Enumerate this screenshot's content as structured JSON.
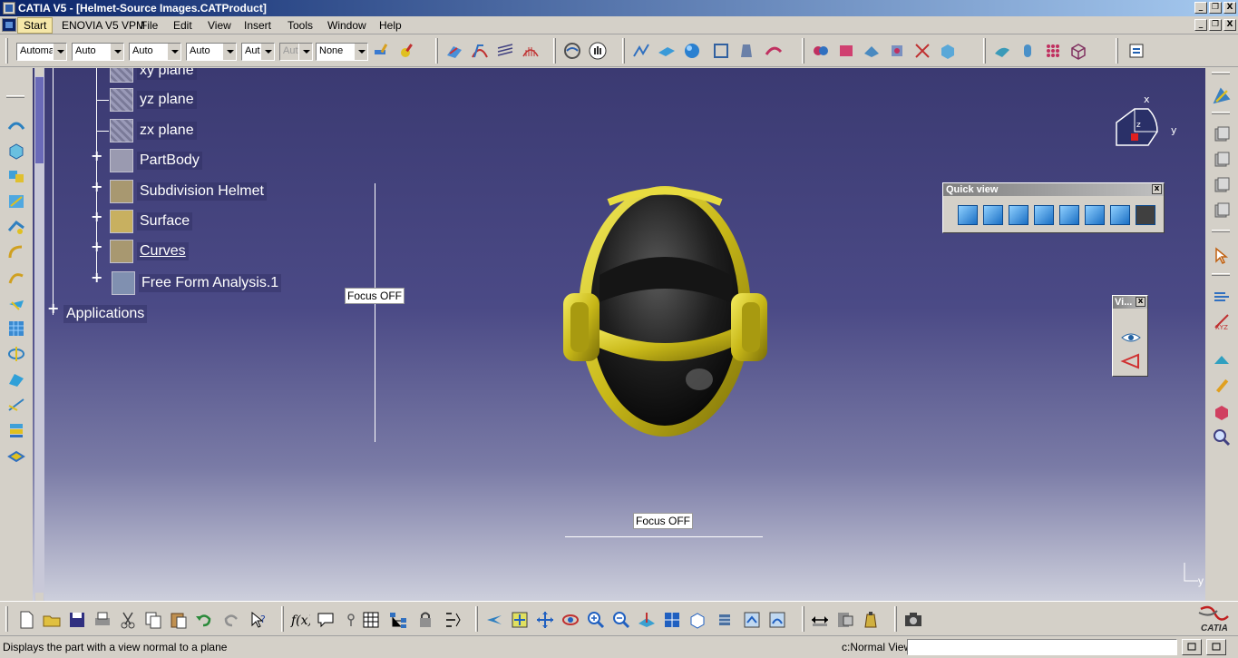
{
  "window": {
    "title": "CATIA V5 - [Helmet-Source Images.CATProduct]",
    "buttons": [
      "_",
      "❐",
      "X"
    ]
  },
  "menubar": {
    "items": [
      "Start",
      "ENOVIA V5 VPM",
      "File",
      "Edit",
      "View",
      "Insert",
      "Tools",
      "Window",
      "Help"
    ]
  },
  "toolbar": {
    "combos": [
      "Automa",
      "Auto",
      "Auto",
      "Auto",
      "Aut",
      "Aut",
      "None"
    ]
  },
  "tree": {
    "nodes": [
      {
        "label": "xy plane",
        "icon": "plane-icon"
      },
      {
        "label": "yz plane",
        "icon": "plane-icon"
      },
      {
        "label": "zx plane",
        "icon": "plane-icon"
      },
      {
        "label": "PartBody",
        "icon": "partbody-icon"
      },
      {
        "label": "Subdivision Helmet",
        "icon": "subdivision-icon"
      },
      {
        "label": "Surface",
        "icon": "surface-icon"
      },
      {
        "label": "Curves",
        "icon": "curves-icon"
      },
      {
        "label": "Free Form Analysis.1",
        "icon": "analysis-icon"
      }
    ],
    "applications": "Applications"
  },
  "viewport": {
    "focus_label_1": "Focus OFF",
    "focus_label_2": "Focus OFF",
    "compass": {
      "x": "x",
      "y": "y",
      "z": "z"
    },
    "corner_axis": "y"
  },
  "quick_view": {
    "title": "Quick view",
    "close": "x",
    "views": [
      "isometric-view",
      "front-view",
      "back-view",
      "left-view",
      "right-view",
      "top-view",
      "bottom-view",
      "named-views"
    ]
  },
  "vi_window": {
    "title": "Vi...",
    "close": "x"
  },
  "statusbar": {
    "message": "Displays the part with a view normal to a plane",
    "mode": "c:Normal View",
    "input_value": ""
  },
  "colors": {
    "viewport_top": "#3b3a72",
    "viewport_bottom": "#cdcfdc",
    "helmet_gold": "#d8cc20",
    "helmet_dark": "#1a1a1a",
    "title_bar": "#0a246a"
  }
}
